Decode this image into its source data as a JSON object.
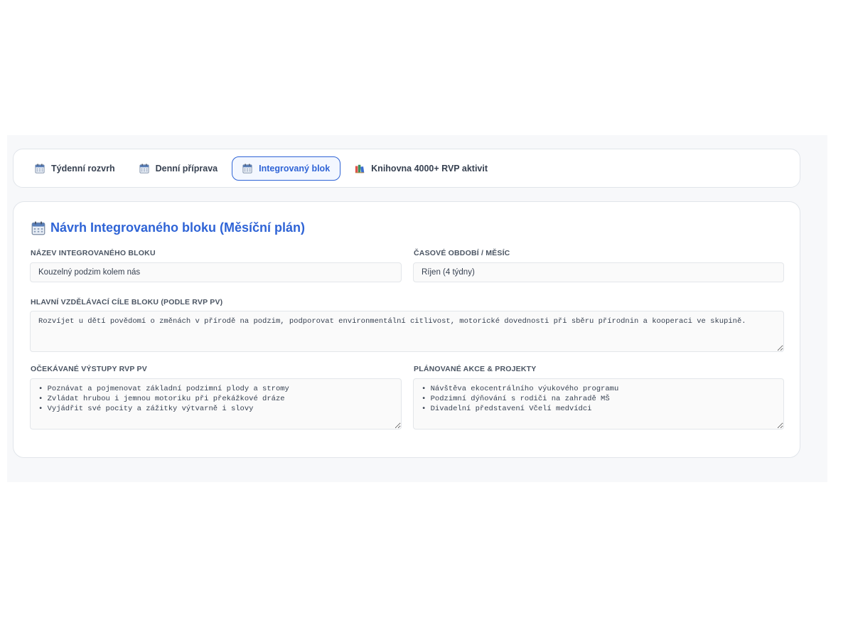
{
  "tabs": [
    {
      "label": "Týdenní rozvrh",
      "icon": "calendar-icon",
      "active": false
    },
    {
      "label": "Denní příprava",
      "icon": "calendar-icon",
      "active": false
    },
    {
      "label": "Integrovaný blok",
      "icon": "calendar-icon",
      "active": true
    },
    {
      "label": "Knihovna 4000+ RVP aktivit",
      "icon": "books-icon",
      "active": false
    }
  ],
  "card": {
    "title": "Návrh Integrovaného bloku (Měsíční plán)",
    "title_icon": "calendar-icon"
  },
  "fields": {
    "block_name": {
      "label": "NÁZEV INTEGROVANÉHO BLOKU",
      "value": "Kouzelný podzim kolem nás"
    },
    "period": {
      "label": "ČASOVÉ OBDOBÍ / MĚSÍC",
      "value": "Říjen (4 týdny)"
    },
    "goals": {
      "label": "HLAVNÍ VZDĚLÁVACÍ CÍLE BLOKU (PODLE RVP PV)",
      "value": "Rozvíjet u dětí povědomí o změnách v přírodě na podzim, podporovat environmentální citlivost, motorické dovednosti při sběru přírodnin a kooperaci ve skupině."
    },
    "outcomes": {
      "label": "OČEKÁVANÉ VÝSTUPY RVP PV",
      "value": "• Poznávat a pojmenovat základní podzimní plody a stromy\n• Zvládat hrubou i jemnou motoriku při překážkové dráze\n• Vyjádřit své pocity a zážitky výtvarně i slovy"
    },
    "events": {
      "label": "PLÁNOVANÉ AKCE & PROJEKTY",
      "value": "• Návštěva ekocentrálního výukového programu\n• Podzimní dýňování s rodiči na zahradě MŠ\n• Divadelní představení Včelí medvídci"
    }
  },
  "colors": {
    "accent": "#2f64d6",
    "text": "#374151",
    "border": "#e1e5ea"
  }
}
